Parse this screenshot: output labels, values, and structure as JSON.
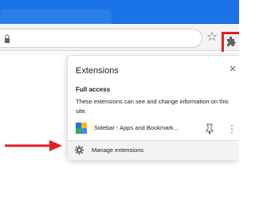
{
  "colors": {
    "chrome_blue": "#1a73e8",
    "highlight_red": "#e41e26"
  },
  "toolbar": {
    "bookmark_icon": "star-icon",
    "extensions_icon": "puzzle-icon"
  },
  "popup": {
    "title": "Extensions",
    "close_glyph": "×",
    "section_heading": "Full access",
    "section_description": "These extensions can see and change information on this site.",
    "extension": {
      "name": "Sidebar - Apps and Bookmark...",
      "more_glyph": "⋮"
    },
    "manage_label": "Manage extensions"
  }
}
